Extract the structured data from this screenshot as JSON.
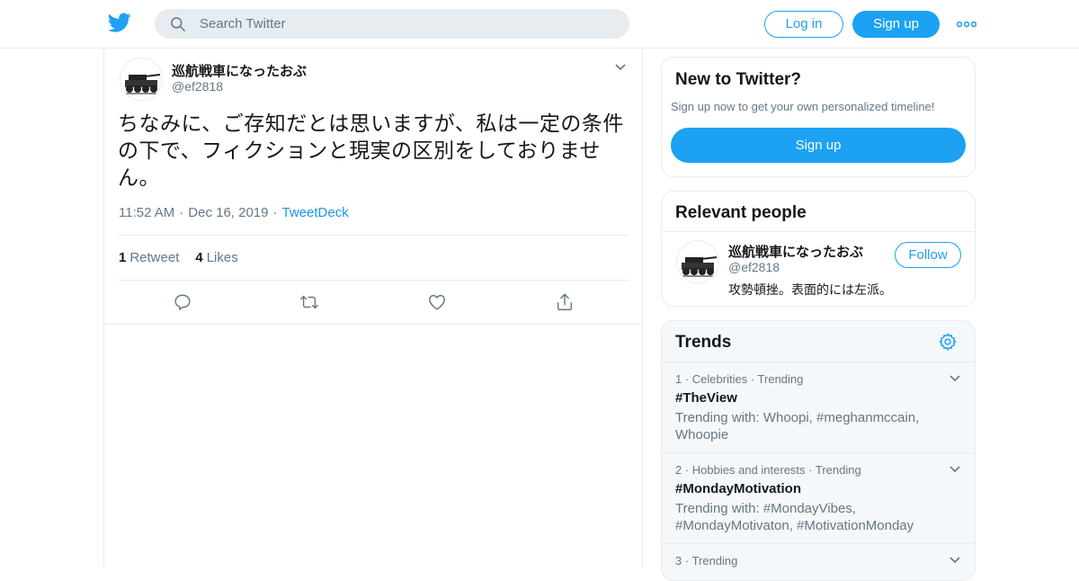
{
  "header": {
    "search_placeholder": "Search Twitter",
    "login_label": "Log in",
    "signup_label": "Sign up"
  },
  "tweet": {
    "author_name": "巡航戦車になったおぶ",
    "author_handle": "@ef2818",
    "text": "ちなみに、ご存知だとは思いますが、私は一定の条件の下で、フィクションと現実の区別をしておりません。",
    "time": "11:52 AM",
    "date": "Dec 16, 2019",
    "source": "TweetDeck",
    "retweets_count": "1",
    "retweets_label": "Retweet",
    "likes_count": "4",
    "likes_label": "Likes"
  },
  "new_to_twitter": {
    "title": "New to Twitter?",
    "subtitle": "Sign up now to get your own personalized timeline!",
    "button_label": "Sign up"
  },
  "relevant_people": {
    "title": "Relevant people",
    "person": {
      "name": "巡航戦車になったおぶ",
      "handle": "@ef2818",
      "bio": "攻勢頓挫。表面的には左派。",
      "follow_label": "Follow"
    }
  },
  "trends": {
    "title": "Trends",
    "items": [
      {
        "rank": "1",
        "category": "Celebrities",
        "status": "Trending",
        "name": "#TheView",
        "with": "Trending with: Whoopi, #meghanmccain, Whoopie"
      },
      {
        "rank": "2",
        "category": "Hobbies and interests",
        "status": "Trending",
        "name": "#MondayMotivation",
        "with": "Trending with: #MondayVibes, #MondayMotivaton, #MotivationMonday"
      },
      {
        "rank": "3",
        "category": "",
        "status": "Trending",
        "name": "",
        "with": ""
      }
    ]
  },
  "colors": {
    "accent": "#1da1f2",
    "link": "#1b95e0",
    "muted_text": "#657786",
    "border": "#e6ecf0",
    "trends_bg": "#f5f8fa"
  }
}
